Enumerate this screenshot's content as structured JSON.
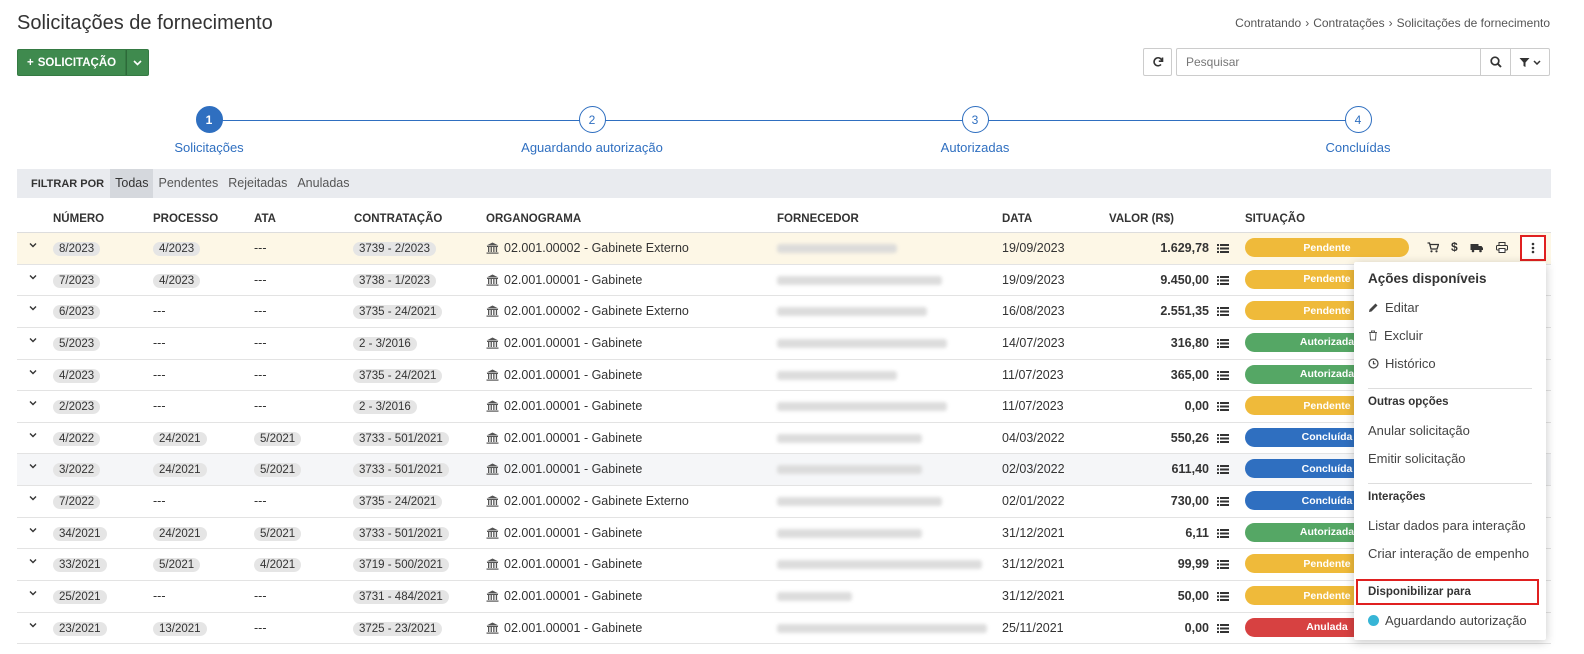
{
  "page": {
    "title": "Solicitações de fornecimento",
    "breadcrumb": [
      "Contratando",
      "Contratações",
      "Solicitações de fornecimento"
    ]
  },
  "toolbar": {
    "new_label": "SOLICITAÇÃO",
    "search_placeholder": "Pesquisar"
  },
  "steps": [
    {
      "number": "1",
      "label": "Solicitações",
      "active": true
    },
    {
      "number": "2",
      "label": "Aguardando autorização",
      "active": false
    },
    {
      "number": "3",
      "label": "Autorizadas",
      "active": false
    },
    {
      "number": "4",
      "label": "Concluídas",
      "active": false
    }
  ],
  "filter": {
    "label": "FILTRAR POR",
    "options": [
      "Todas",
      "Pendentes",
      "Rejeitadas",
      "Anuladas"
    ],
    "selected": "Todas"
  },
  "table": {
    "columns": [
      "NÚMERO",
      "PROCESSO",
      "ATA",
      "CONTRATAÇÃO",
      "ORGANOGRAMA",
      "FORNECEDOR",
      "DATA",
      "VALOR (R$)",
      "SITUAÇÃO"
    ],
    "rows": [
      {
        "numero": "8/2023",
        "processo": "4/2023",
        "ata": "---",
        "contratacao": "3739 - 2/2023",
        "organograma": "02.001.00002 - Gabinete Externo",
        "data": "19/09/2023",
        "valor": "1.629,78",
        "situacao": "Pendente"
      },
      {
        "numero": "7/2023",
        "processo": "4/2023",
        "ata": "---",
        "contratacao": "3738 - 1/2023",
        "organograma": "02.001.00001 - Gabinete",
        "data": "19/09/2023",
        "valor": "9.450,00",
        "situacao": "Pendente"
      },
      {
        "numero": "6/2023",
        "processo": "---",
        "ata": "---",
        "contratacao": "3735 - 24/2021",
        "organograma": "02.001.00002 - Gabinete Externo",
        "data": "16/08/2023",
        "valor": "2.551,35",
        "situacao": "Pendente"
      },
      {
        "numero": "5/2023",
        "processo": "---",
        "ata": "---",
        "contratacao": "2 - 3/2016",
        "organograma": "02.001.00001 - Gabinete",
        "data": "14/07/2023",
        "valor": "316,80",
        "situacao": "Autorizada"
      },
      {
        "numero": "4/2023",
        "processo": "---",
        "ata": "---",
        "contratacao": "3735 - 24/2021",
        "organograma": "02.001.00001 - Gabinete",
        "data": "11/07/2023",
        "valor": "365,00",
        "situacao": "Autorizada"
      },
      {
        "numero": "2/2023",
        "processo": "---",
        "ata": "---",
        "contratacao": "2 - 3/2016",
        "organograma": "02.001.00001 - Gabinete",
        "data": "11/07/2023",
        "valor": "0,00",
        "situacao": "Pendente"
      },
      {
        "numero": "4/2022",
        "processo": "24/2021",
        "ata": "5/2021",
        "contratacao": "3733 - 501/2021",
        "organograma": "02.001.00001 - Gabinete",
        "data": "04/03/2022",
        "valor": "550,26",
        "situacao": "Concluída"
      },
      {
        "numero": "3/2022",
        "processo": "24/2021",
        "ata": "5/2021",
        "contratacao": "3733 - 501/2021",
        "organograma": "02.001.00001 - Gabinete",
        "data": "02/03/2022",
        "valor": "611,40",
        "situacao": "Concluída"
      },
      {
        "numero": "7/2022",
        "processo": "---",
        "ata": "---",
        "contratacao": "3735 - 24/2021",
        "organograma": "02.001.00002 - Gabinete Externo",
        "data": "02/01/2022",
        "valor": "730,00",
        "situacao": "Concluída"
      },
      {
        "numero": "34/2021",
        "processo": "24/2021",
        "ata": "5/2021",
        "contratacao": "3733 - 501/2021",
        "organograma": "02.001.00001 - Gabinete",
        "data": "31/12/2021",
        "valor": "6,11",
        "situacao": "Autorizada"
      },
      {
        "numero": "33/2021",
        "processo": "5/2021",
        "ata": "4/2021",
        "contratacao": "3719 - 500/2021",
        "organograma": "02.001.00001 - Gabinete",
        "data": "31/12/2021",
        "valor": "99,99",
        "situacao": "Pendente"
      },
      {
        "numero": "25/2021",
        "processo": "---",
        "ata": "---",
        "contratacao": "3731 - 484/2021",
        "organograma": "02.001.00001 - Gabinete",
        "data": "31/12/2021",
        "valor": "50,00",
        "situacao": "Pendente"
      },
      {
        "numero": "23/2021",
        "processo": "13/2021",
        "ata": "---",
        "contratacao": "3725 - 23/2021",
        "organograma": "02.001.00001 - Gabinete",
        "data": "25/11/2021",
        "valor": "0,00",
        "situacao": "Anulada"
      }
    ]
  },
  "dropdown": {
    "title": "Ações disponíveis",
    "actions": [
      "Editar",
      "Excluir",
      "Histórico"
    ],
    "outras_title": "Outras opções",
    "outras": [
      "Anular solicitação",
      "Emitir solicitação"
    ],
    "interacoes_title": "Interações",
    "interacoes": [
      "Listar dados para interação",
      "Criar interação de empenho"
    ],
    "disponibilizar_title": "Disponibilizar para",
    "disponibilizar": [
      "Aguardando autorização"
    ]
  },
  "colors": {
    "primary_green": "#3f8a4e",
    "step_blue": "#2f6fc0",
    "pendente": "#efba3a",
    "autorizada": "#55a765",
    "concluida": "#2f6fc0",
    "anulada": "#d74141",
    "highlight_red": "#e02020"
  }
}
